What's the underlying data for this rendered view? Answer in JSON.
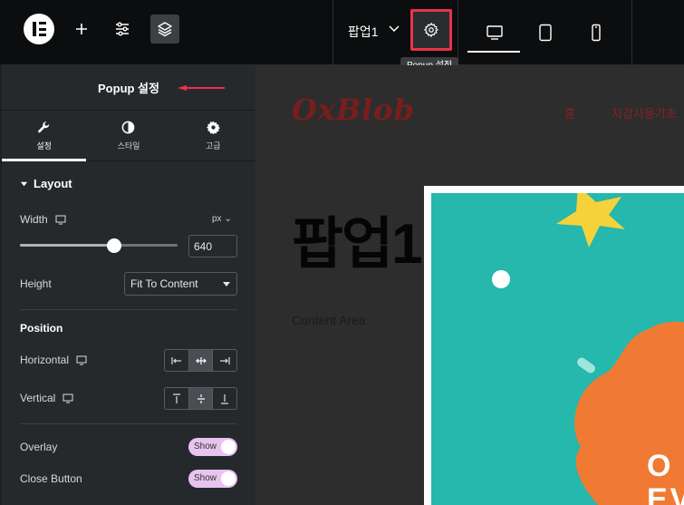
{
  "topbar": {
    "document_title": "팝업1",
    "settings_tooltip": "Popup 설정"
  },
  "panel": {
    "title": "Popup 설정",
    "tabs": [
      {
        "label": "설정",
        "icon": "wrench-icon",
        "active": true
      },
      {
        "label": "스타일",
        "icon": "half-circle-icon",
        "active": false
      },
      {
        "label": "고급",
        "icon": "gear-icon",
        "active": false
      }
    ],
    "layout": {
      "title": "Layout",
      "width_label": "Width",
      "unit": "px",
      "width_value": "640",
      "height_label": "Height",
      "height_value": "Fit To Content"
    },
    "position": {
      "title": "Position",
      "horizontal_label": "Horizontal",
      "vertical_label": "Vertical"
    },
    "overlay": {
      "label": "Overlay",
      "toggle": "Show"
    },
    "close_button": {
      "label": "Close Button",
      "toggle": "Show"
    }
  },
  "canvas": {
    "site_logo": "OxBlob",
    "nav_home": "홈",
    "nav_other": "지갑사용기초",
    "page_heading": "팝업1",
    "content_area": "Content Area",
    "popup_text_line1": "O",
    "popup_text_line2": "EV"
  },
  "colors": {
    "highlight": "#e8334a",
    "popup_bg": "#26b7ad",
    "popup_blob": "#f07a33",
    "toggle": "#e8c3f0"
  }
}
